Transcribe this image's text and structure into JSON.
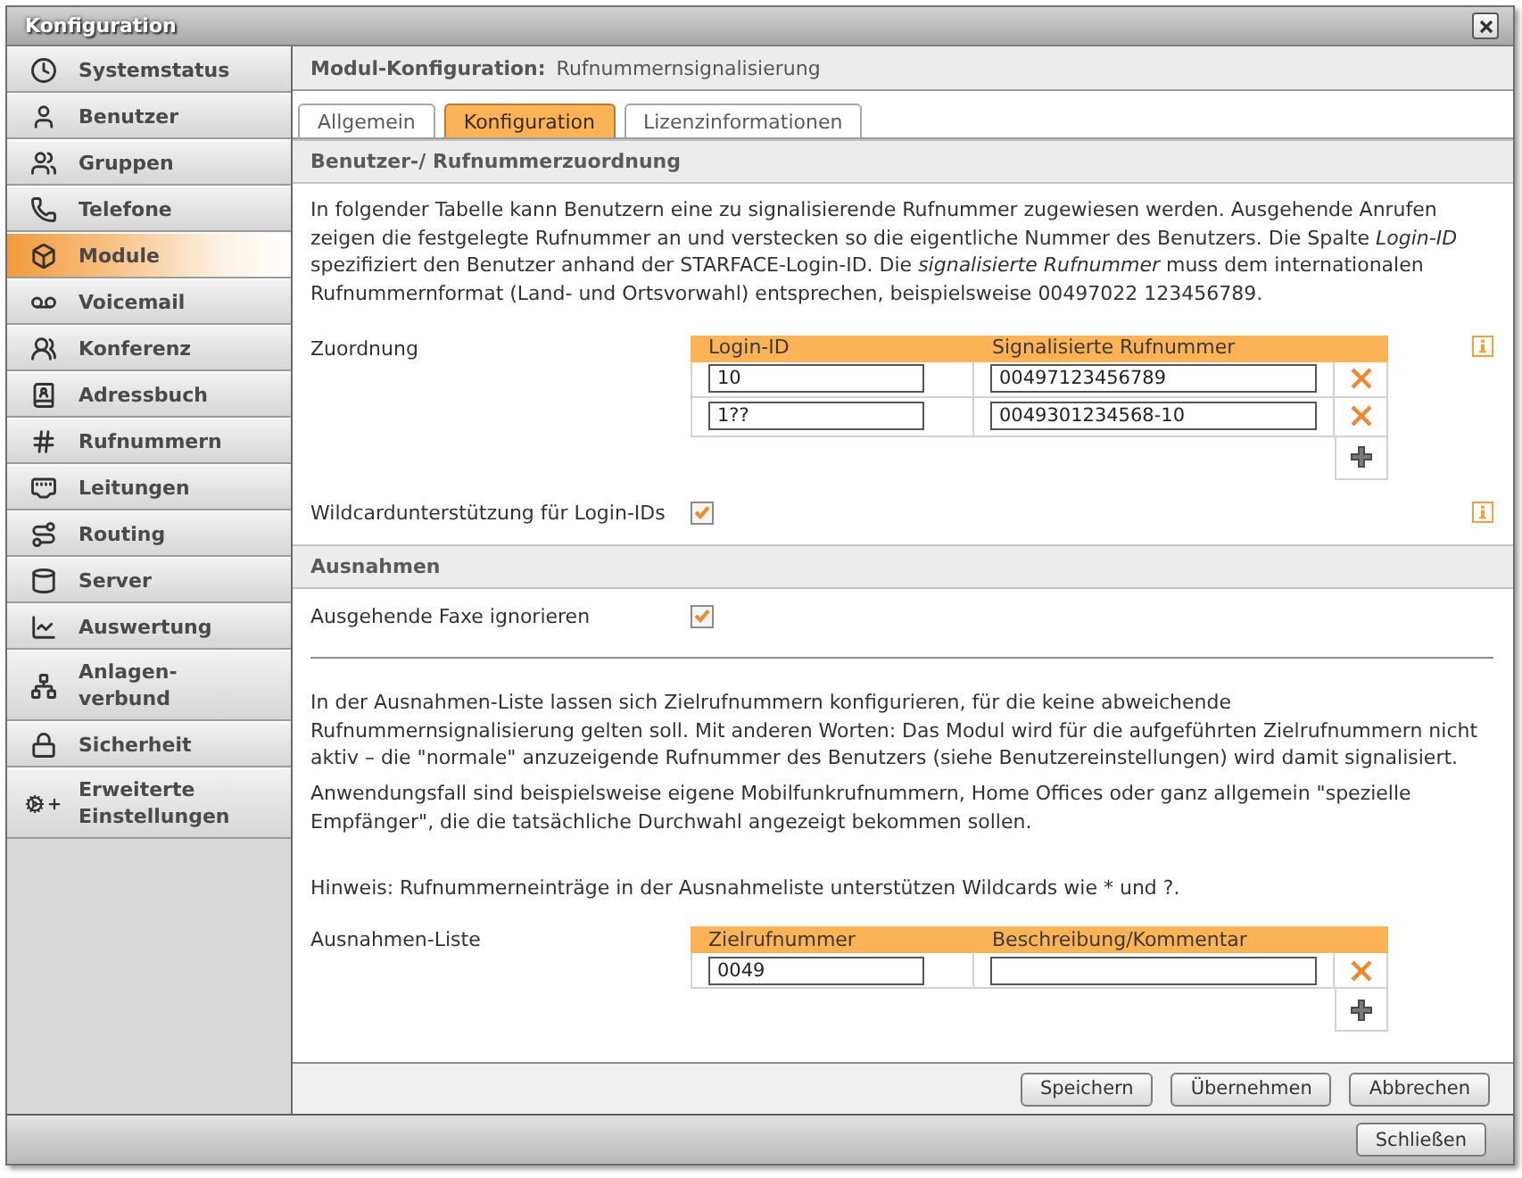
{
  "window": {
    "title": "Konfiguration"
  },
  "sidebar": {
    "items": [
      {
        "label": "Systemstatus",
        "selected": false
      },
      {
        "label": "Benutzer",
        "selected": false
      },
      {
        "label": "Gruppen",
        "selected": false
      },
      {
        "label": "Telefone",
        "selected": false
      },
      {
        "label": "Module",
        "selected": true
      },
      {
        "label": "Voicemail",
        "selected": false
      },
      {
        "label": "Konferenz",
        "selected": false
      },
      {
        "label": "Adressbuch",
        "selected": false
      },
      {
        "label": "Rufnummern",
        "selected": false
      },
      {
        "label": "Leitungen",
        "selected": false
      },
      {
        "label": "Routing",
        "selected": false
      },
      {
        "label": "Server",
        "selected": false
      },
      {
        "label": "Auswertung",
        "selected": false
      },
      {
        "label": "Anlagen-verbund",
        "selected": false
      },
      {
        "label": "Sicherheit",
        "selected": false
      },
      {
        "label": "Erweiterte Einstellungen",
        "selected": false
      }
    ]
  },
  "module_header": {
    "label": "Modul-Konfiguration:",
    "value": "Rufnummernsignalisierung"
  },
  "tabs": [
    {
      "label": "Allgemein",
      "selected": false
    },
    {
      "label": "Konfiguration",
      "selected": true
    },
    {
      "label": "Lizenzinformationen",
      "selected": false
    }
  ],
  "assignment_section": {
    "title": "Benutzer-/ Rufnummerzuordnung",
    "description": "In folgender Tabelle kann Benutzern eine zu signalisierende Rufnummer zugewiesen werden. Ausgehende Anrufen zeigen die festgelegte Rufnummer an und verstecken so die eigentliche Nummer des Benutzers. Die Spalte *Login-ID* spezifiziert den Benutzer anhand der STARFACE-Login-ID. Die *signalisierte Rufnummer* muss dem internationalen Rufnummernformat (Land- und Ortsvorwahl) entsprechen, beispielsweise 00497022 123456789.",
    "table": {
      "label": "Zuordnung",
      "columns": [
        "Login-ID",
        "Signalisierte Rufnummer"
      ],
      "rows": [
        {
          "values": [
            "10",
            "00497123456789"
          ]
        },
        {
          "values": [
            "1??",
            "0049301234568-10"
          ]
        }
      ]
    },
    "wildcard_option": {
      "label": "Wildcardunterstützung für Login-IDs",
      "checked": true
    }
  },
  "exceptions_section": {
    "title": "Ausnahmen",
    "fax_option": {
      "label": "Ausgehende Faxe ignorieren",
      "checked": true
    },
    "paragraphs": [
      "In der Ausnahmen-Liste lassen sich Zielrufnummern konfigurieren, für die keine abweichende Rufnummernsignalisierung gelten soll. Mit anderen Worten: Das Modul wird für die aufgeführten Zielrufnummern nicht aktiv – die \"normale\" anzuzeigende Rufnummer des Benutzers (siehe Benutzereinstellungen) wird damit signalisiert.",
      "Anwendungsfall sind beispielsweise eigene Mobilfunkrufnummern, Home Offices oder ganz allgemein \"spezielle Empfänger\", die die tatsächliche Durchwahl angezeigt bekommen sollen."
    ],
    "note": "Hinweis: Rufnummerneinträge in der Ausnahmeliste unterstützen Wildcards wie * und ?.",
    "table": {
      "label": "Ausnahmen-Liste",
      "columns": [
        "Zielrufnummer",
        "Beschreibung/Kommentar"
      ],
      "rows": [
        {
          "values": [
            "0049"
          ]
        }
      ]
    }
  },
  "footer_buttons": [
    "Speichern",
    "Übernehmen",
    "Abbrechen"
  ],
  "close_button": "Schließen"
}
